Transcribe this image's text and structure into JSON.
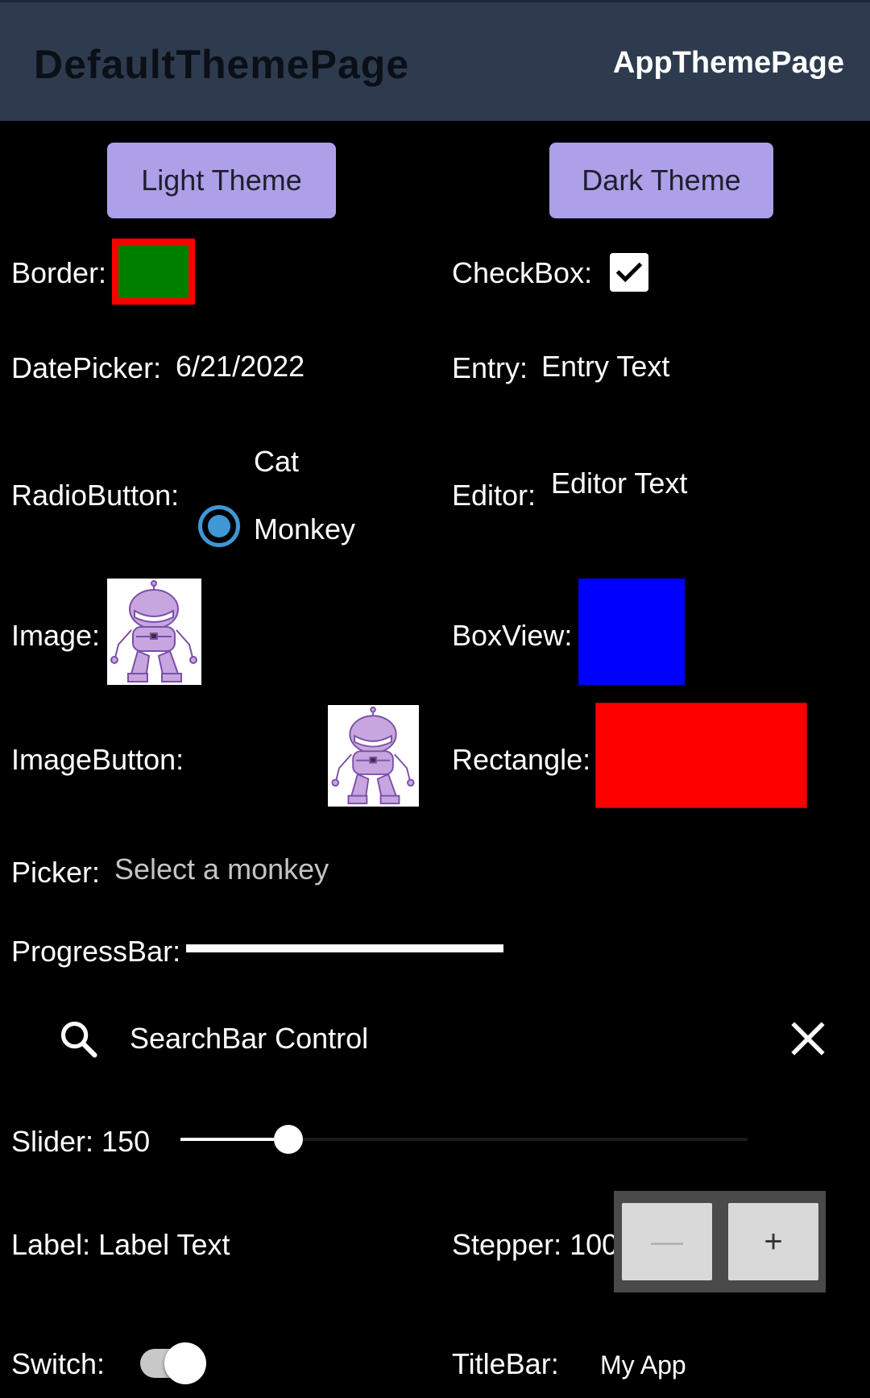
{
  "header": {
    "tab_active": "DefaultThemePage",
    "tab_other": "AppThemePage"
  },
  "buttons": {
    "light_theme": "Light Theme",
    "dark_theme": "Dark Theme"
  },
  "controls": {
    "border_label": "Border:",
    "checkbox_label": "CheckBox:",
    "checkbox_checked": true,
    "datepicker_label": "DatePicker:",
    "datepicker_value": "6/21/2022",
    "entry_label": "Entry:",
    "entry_value": "Entry Text",
    "radio_label": "RadioButton:",
    "radio_option_1": "Cat",
    "radio_option_2": "Monkey",
    "radio_selected": "Monkey",
    "editor_label": "Editor:",
    "editor_value": "Editor Text",
    "image_label": "Image:",
    "boxview_label": "BoxView:",
    "imagebutton_label": "ImageButton:",
    "rectangle_label": "Rectangle:",
    "picker_label": "Picker:",
    "picker_placeholder": "Select a monkey",
    "progressbar_label": "ProgressBar:",
    "progress_value": 1.0,
    "searchbar_text": "SearchBar Control",
    "slider_label": "Slider: 150",
    "slider_fraction": 0.19,
    "label_label": "Label: Label Text",
    "stepper_label": "Stepper: 100",
    "stepper_minus": "—",
    "stepper_plus": "+",
    "switch_label": "Switch:",
    "switch_on": true,
    "titlebar_label": "TitleBar:",
    "titlebar_value": "My App"
  },
  "colors": {
    "header_bg": "#2e3b4e",
    "theme_button": "#ad9fe8",
    "border_stroke": "#ff0000",
    "border_fill": "#008000",
    "boxview": "#0000ff",
    "rectangle": "#ff0000",
    "radio_accent": "#3f97d6"
  },
  "icons": {
    "search": "search-icon",
    "clear": "close-icon",
    "bot": "dotnet-bot-icon",
    "check": "check-icon"
  }
}
